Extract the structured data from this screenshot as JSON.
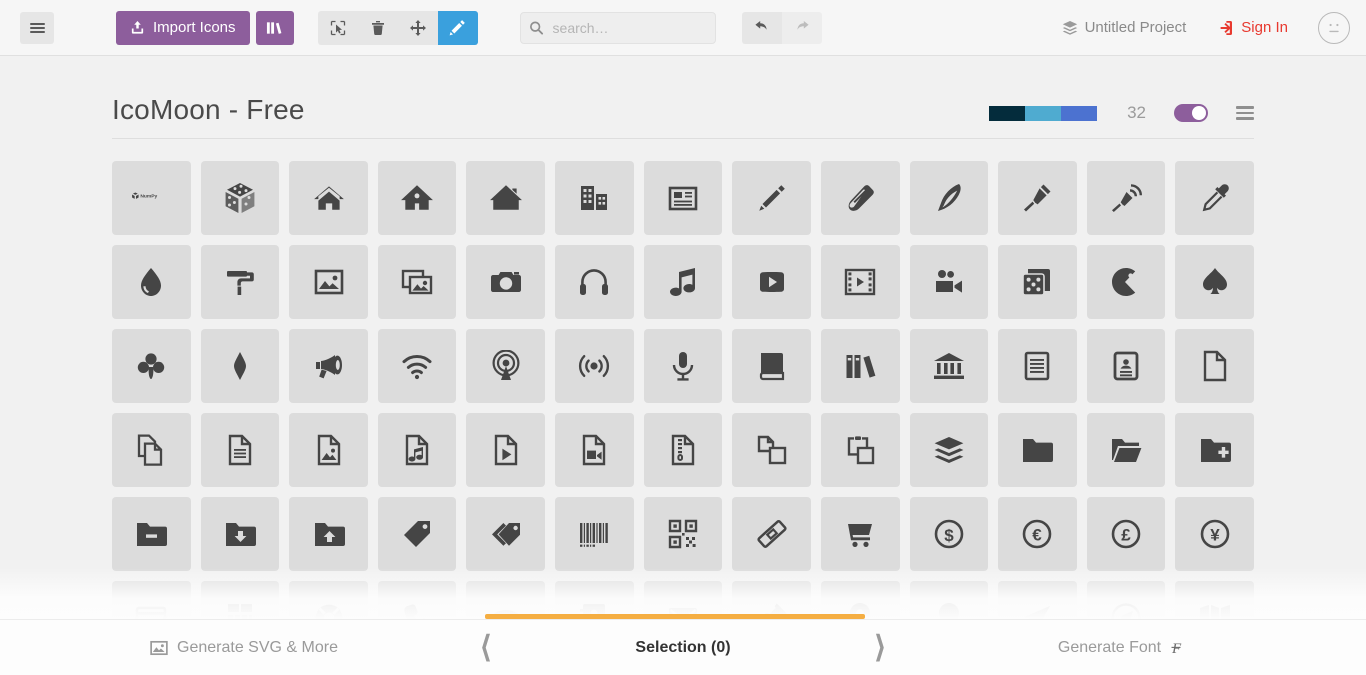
{
  "toolbar": {
    "menu_icon": "hamburger-icon",
    "import_label": "Import Icons",
    "import_icon": "upload-icon",
    "library_icon": "library-icon",
    "tools": [
      {
        "name": "select-tool",
        "icon": "cursor-select-icon",
        "active": false
      },
      {
        "name": "delete-tool",
        "icon": "trash-icon",
        "active": false
      },
      {
        "name": "move-tool",
        "icon": "move-arrows-icon",
        "active": false
      },
      {
        "name": "edit-tool",
        "icon": "pencil-icon",
        "active": true
      }
    ],
    "search": {
      "value": "",
      "placeholder": "search…",
      "icon": "search-icon"
    },
    "undo_icon": "undo-arrow-icon",
    "redo_icon": "redo-arrow-icon",
    "project_label": "Untitled Project",
    "project_icon": "stack-icon",
    "signin_label": "Sign In",
    "signin_icon": "login-icon",
    "avatar_icon": "neutral-face-icon",
    "accent_purple": "#8d5e9c",
    "accent_blue": "#3aa0dd",
    "accent_red": "#e8392f"
  },
  "iconset": {
    "title": "IcoMoon - Free",
    "swatches": [
      "#042c3c",
      "#4fabd0",
      "#4c72d0"
    ],
    "size_value": "32",
    "toggle_on": true,
    "menu_icon": "list-menu-icon"
  },
  "icons": [
    {
      "name": "numpy-logo-icon"
    },
    {
      "name": "numpy-cube-icon"
    },
    {
      "name": "home-icon"
    },
    {
      "name": "home2-icon"
    },
    {
      "name": "home3-icon"
    },
    {
      "name": "office-icon"
    },
    {
      "name": "newspaper-icon"
    },
    {
      "name": "pencil-icon"
    },
    {
      "name": "pencil2-icon"
    },
    {
      "name": "quill-icon"
    },
    {
      "name": "pen-icon"
    },
    {
      "name": "blog-icon"
    },
    {
      "name": "eyedropper-icon"
    },
    {
      "name": "droplet-icon"
    },
    {
      "name": "paint-format-icon"
    },
    {
      "name": "image-icon"
    },
    {
      "name": "images-icon"
    },
    {
      "name": "camera-icon"
    },
    {
      "name": "headphones-icon"
    },
    {
      "name": "music-icon"
    },
    {
      "name": "play-icon"
    },
    {
      "name": "film-icon"
    },
    {
      "name": "video-camera-icon"
    },
    {
      "name": "dice-icon"
    },
    {
      "name": "pacman-icon"
    },
    {
      "name": "spades-icon"
    },
    {
      "name": "clubs-icon"
    },
    {
      "name": "diamonds-icon"
    },
    {
      "name": "bullhorn-icon"
    },
    {
      "name": "connection-icon"
    },
    {
      "name": "podcast-icon"
    },
    {
      "name": "radio-icon"
    },
    {
      "name": "mic-icon"
    },
    {
      "name": "book-icon"
    },
    {
      "name": "books-icon"
    },
    {
      "name": "library-icon"
    },
    {
      "name": "file-text-icon"
    },
    {
      "name": "profile-icon"
    },
    {
      "name": "file-empty-icon"
    },
    {
      "name": "files-empty-icon"
    },
    {
      "name": "file-text2-icon"
    },
    {
      "name": "file-picture-icon"
    },
    {
      "name": "file-music-icon"
    },
    {
      "name": "file-play-icon"
    },
    {
      "name": "file-video-icon"
    },
    {
      "name": "file-zip-icon"
    },
    {
      "name": "copy-icon"
    },
    {
      "name": "paste-icon"
    },
    {
      "name": "stack-icon"
    },
    {
      "name": "folder-icon"
    },
    {
      "name": "folder-open-icon"
    },
    {
      "name": "folder-plus-icon"
    },
    {
      "name": "folder-minus-icon"
    },
    {
      "name": "folder-download-icon"
    },
    {
      "name": "folder-upload-icon"
    },
    {
      "name": "price-tag-icon"
    },
    {
      "name": "price-tags-icon"
    },
    {
      "name": "barcode-icon"
    },
    {
      "name": "qrcode-icon"
    },
    {
      "name": "ticket-icon"
    },
    {
      "name": "cart-icon"
    },
    {
      "name": "coin-dollar-icon"
    },
    {
      "name": "coin-euro-icon"
    },
    {
      "name": "coin-pound-icon"
    },
    {
      "name": "coin-yen-icon"
    },
    {
      "name": "credit-card-icon"
    },
    {
      "name": "calculator-icon"
    },
    {
      "name": "lifebuoy-icon"
    },
    {
      "name": "phone-icon"
    },
    {
      "name": "phone-hang-up-icon"
    },
    {
      "name": "address-book-icon"
    },
    {
      "name": "envelop-icon"
    },
    {
      "name": "pushpin-icon"
    },
    {
      "name": "location-icon"
    },
    {
      "name": "location2-icon"
    },
    {
      "name": "compass-icon"
    },
    {
      "name": "compass2-icon"
    },
    {
      "name": "map-icon"
    }
  ],
  "footer": {
    "left_label": "Generate SVG & More",
    "left_icon": "image-icon",
    "center_label": "Selection (0)",
    "prev_icon": "chevron-left-icon",
    "next_icon": "chevron-right-icon",
    "right_label": "Generate Font",
    "right_icon": "font-f-icon",
    "progress_color": "#f5ae42"
  }
}
